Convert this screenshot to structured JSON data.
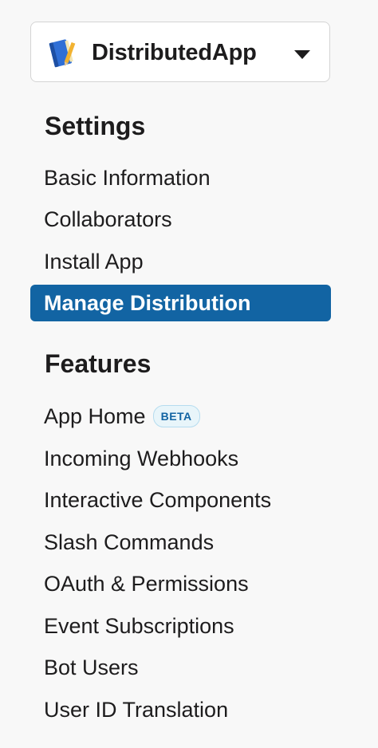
{
  "app_switcher": {
    "app_name": "DistributedApp",
    "icon": "notebook-icon",
    "caret_icon": "caret-down-icon"
  },
  "settings": {
    "heading": "Settings",
    "items": [
      {
        "label": "Basic Information",
        "active": false
      },
      {
        "label": "Collaborators",
        "active": false
      },
      {
        "label": "Install App",
        "active": false
      },
      {
        "label": "Manage Distribution",
        "active": true
      }
    ]
  },
  "features": {
    "heading": "Features",
    "items": [
      {
        "label": "App Home",
        "badge": "BETA"
      },
      {
        "label": "Incoming Webhooks"
      },
      {
        "label": "Interactive Components"
      },
      {
        "label": "Slash Commands"
      },
      {
        "label": "OAuth & Permissions"
      },
      {
        "label": "Event Subscriptions"
      },
      {
        "label": "Bot Users"
      },
      {
        "label": "User ID Translation"
      }
    ]
  },
  "colors": {
    "active_background": "#1264a3",
    "sidebar_background": "#f8f8f8",
    "badge_background": "#e8f5fa",
    "badge_text": "#1264a3"
  }
}
